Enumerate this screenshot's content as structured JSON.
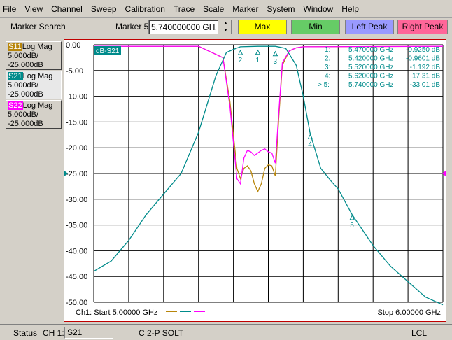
{
  "menu": [
    "File",
    "View",
    "Channel",
    "Sweep",
    "Calibration",
    "Trace",
    "Scale",
    "Marker",
    "System",
    "Window",
    "Help"
  ],
  "toolbar": {
    "marker_search_label": "Marker Search",
    "marker_name": "Marker 5",
    "marker_freq": "5.740000000 GHz",
    "buttons": [
      {
        "label": "Max",
        "color": "#ffff00"
      },
      {
        "label": "Min",
        "color": "#66cc66"
      },
      {
        "label": "Left Peak",
        "color": "#9999ff"
      },
      {
        "label": "Right Peak",
        "color": "#ff6699"
      }
    ]
  },
  "traces": [
    {
      "tag": "S11",
      "fmt": "Log Mag",
      "scale": "5.000dB/",
      "ref": "-25.000dB",
      "color": "#b8860b"
    },
    {
      "tag": "S21",
      "fmt": "Log Mag",
      "scale": "5.000dB/",
      "ref": "-25.000dB",
      "color": "#008b8b"
    },
    {
      "tag": "S22",
      "fmt": "Log Mag",
      "scale": "5.000dB/",
      "ref": "-25.000dB",
      "color": "#ff00ff"
    }
  ],
  "chart_data": {
    "type": "line",
    "trace_label": "dB-S21",
    "xlim": [
      5.0,
      6.0
    ],
    "ylim": [
      -50,
      0
    ],
    "yticks": [
      "0.00",
      "-5.00",
      "-10.00",
      "-15.00",
      "-20.00",
      "-25.00",
      "-30.00",
      "-35.00",
      "-40.00",
      "-45.00",
      "-50.00"
    ],
    "start_label": "Ch1: Start  5.00000 GHz",
    "stop_label": "Stop  6.00000 GHz",
    "series": [
      {
        "color": "#b8860b",
        "x": [
          5.0,
          5.3,
          5.37,
          5.39,
          5.41,
          5.42,
          5.43,
          5.44,
          5.45,
          5.46,
          5.47,
          5.48,
          5.49,
          5.5,
          5.51,
          5.52,
          5.53,
          5.54,
          5.56,
          5.58,
          5.6,
          6.0
        ],
        "y": [
          -0.3,
          -0.3,
          -2.5,
          -11,
          -24,
          -26,
          -24,
          -23.5,
          -24.5,
          -27,
          -28.5,
          -27,
          -24,
          -23.3,
          -23.5,
          -25.5,
          -14,
          -4,
          -1.2,
          -0.6,
          -0.4,
          -0.3
        ]
      },
      {
        "color": "#ff00ff",
        "x": [
          5.0,
          5.3,
          5.37,
          5.39,
          5.41,
          5.42,
          5.43,
          5.44,
          5.45,
          5.46,
          5.47,
          5.48,
          5.49,
          5.5,
          5.51,
          5.52,
          5.53,
          5.54,
          5.56,
          5.58,
          5.6,
          6.0
        ],
        "y": [
          -0.3,
          -0.3,
          -2.5,
          -12,
          -26,
          -27,
          -22,
          -20.5,
          -20.8,
          -21.5,
          -21,
          -20.5,
          -20.2,
          -20.8,
          -21,
          -23,
          -13,
          -3.5,
          -1.2,
          -0.6,
          -0.4,
          -0.3
        ]
      },
      {
        "color": "#008b8b",
        "x": [
          5.0,
          5.05,
          5.1,
          5.15,
          5.2,
          5.25,
          5.3,
          5.35,
          5.38,
          5.4,
          5.42,
          5.47,
          5.52,
          5.55,
          5.58,
          5.6,
          5.62,
          5.65,
          5.68,
          5.7,
          5.74,
          5.8,
          5.85,
          5.9,
          5.95,
          6.0
        ],
        "y": [
          -44,
          -42,
          -38,
          -33,
          -29,
          -25,
          -17,
          -6,
          -1.5,
          -0.9,
          -0.4,
          -0.3,
          -0.3,
          -0.7,
          -4,
          -10,
          -17.3,
          -24,
          -26.5,
          -28,
          -33,
          -39,
          -43,
          -46,
          -49,
          -50.5
        ]
      }
    ],
    "markers": [
      {
        "id": "1",
        "freq": "5.470000 GHz",
        "val": "-0.9250 dB",
        "x": 5.47,
        "y": -0.925
      },
      {
        "id": "2",
        "freq": "5.420000 GHz",
        "val": "-0.9601 dB",
        "x": 5.42,
        "y": -0.96
      },
      {
        "id": "3",
        "freq": "5.520000 GHz",
        "val": "-1.192 dB",
        "x": 5.52,
        "y": -1.192
      },
      {
        "id": "4",
        "freq": "5.620000 GHz",
        "val": "-17.31 dB",
        "x": 5.62,
        "y": -17.31
      },
      {
        "id": "5",
        "freq": "5.740000 GHz",
        "val": "-33.01 dB",
        "x": 5.74,
        "y": -33.01,
        "active": true
      }
    ]
  },
  "status": {
    "label": "Status",
    "channel": "CH 1:",
    "field": "S21",
    "mode": "C  2-P SOLT",
    "lcl": "LCL"
  }
}
